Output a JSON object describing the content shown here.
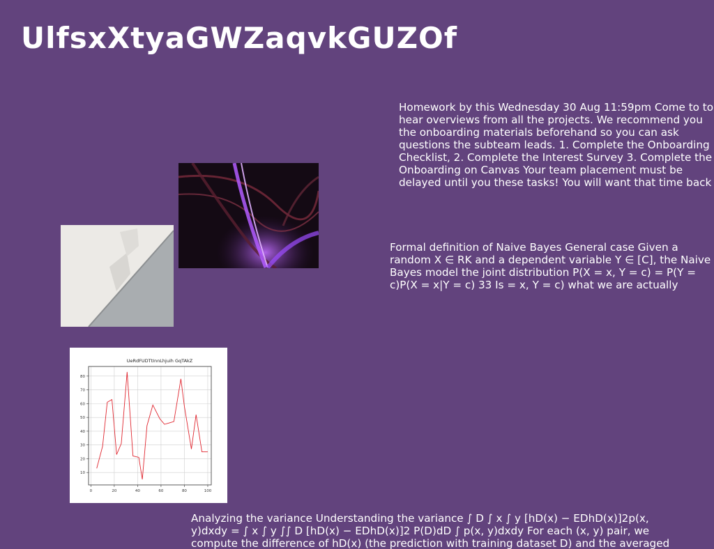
{
  "page": {
    "title": "UlfsxXtyaGWZaqvkGUZOf",
    "background_color": "#62437d"
  },
  "paragraphs": {
    "p1": "Homework by this Wednesday 30 Aug 11:59pm Come to to hear overviews from all the projects. We recommend you the onboarding materials beforehand so you can ask questions the subteam leads. 1. Complete the Onboarding Checklist, 2. Complete the Interest Survey 3. Complete the Onboarding on Canvas Your team placement must be delayed until you these tasks! You will want that time back at the end of the",
    "p2": "Formal definition of Naive Bayes General case Given a random X ∈ RK and a dependent variable Y ∈ [C], the Naive Bayes model the joint distribution P(X = x, Y = c) = P(Y = c)P(X = x|Y = c) 33 Is = x, Y = c) what we are actually interested in for the prediction? I",
    "p3": "Analyzing the variance Understanding the variance ∫ D ∫ x ∫ y [hD(x) − EDhD(x)]2p(x, y)dxdy = ∫ x ∫ y ∫∫ D [hD(x) − EDhD(x)]2 P(D)dD ∫ p(x, y)dxdy For each (x, y) pair, we compute the difference of hD(x) (the prediction with training dataset D) and the averaged prediction EDhD(x):"
  },
  "images": {
    "swirl": "abstract purple light swirl photo",
    "wall": "white concrete step on grey pavement photo"
  },
  "chart_data": {
    "type": "line",
    "title": "UeRdFUDTtInnLhjuih GqTAkZ",
    "xlabel": "",
    "ylabel": "",
    "x": [
      5,
      10,
      14,
      18,
      22,
      26,
      31,
      36,
      41,
      44,
      48,
      53,
      59,
      63,
      67,
      71,
      77,
      80,
      86,
      90,
      95,
      100
    ],
    "series": [
      {
        "values": [
          13,
          29,
          61,
          63,
          23,
          31,
          83,
          22,
          21,
          5,
          44,
          59,
          49,
          45,
          46,
          47,
          78,
          58,
          27,
          52,
          25,
          25
        ],
        "color": "#e0262f"
      }
    ],
    "xticks": [
      "0",
      "20",
      "40",
      "60",
      "80",
      "100"
    ],
    "yticks": [
      "10",
      "20",
      "30",
      "40",
      "50",
      "60",
      "70",
      "80"
    ],
    "xlim": [
      -2,
      103
    ],
    "ylim": [
      1,
      87
    ],
    "grid": true
  }
}
